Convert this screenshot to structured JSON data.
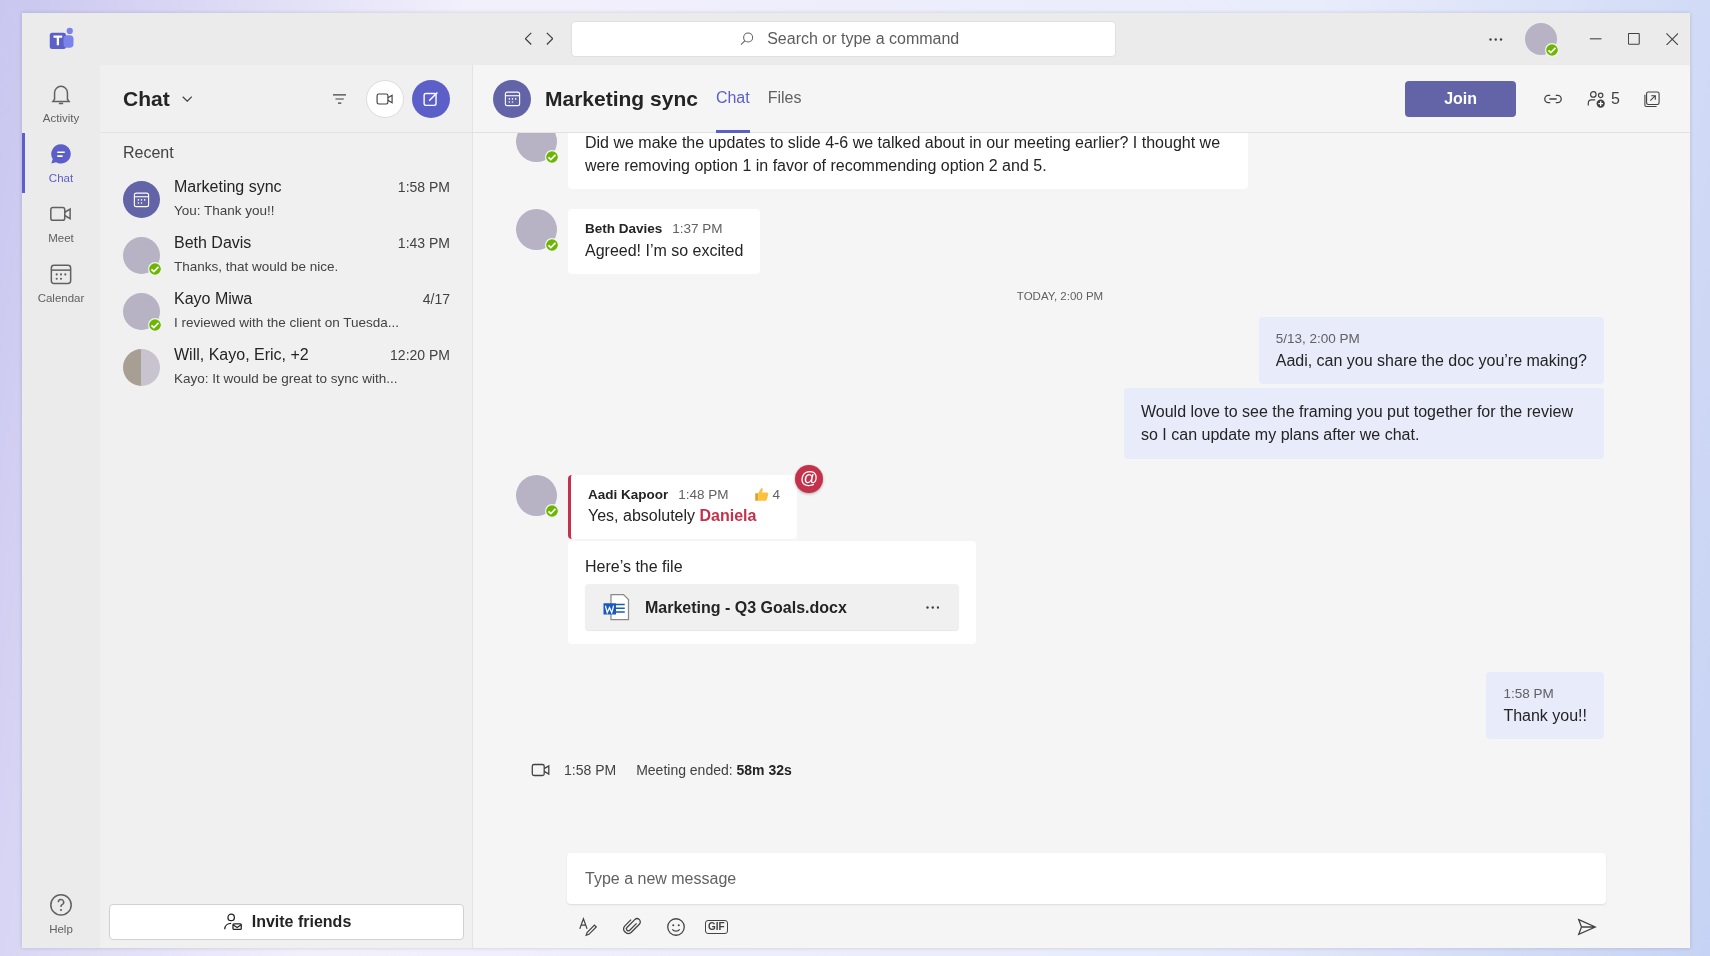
{
  "titlebar": {
    "search": {
      "placeholder": "Search or type a command"
    },
    "user_available": true
  },
  "rail": {
    "items": [
      {
        "label": "Activity",
        "kind": "activity",
        "selected": false
      },
      {
        "label": "Chat",
        "kind": "chat",
        "selected": true
      },
      {
        "label": "Meet",
        "kind": "meet",
        "selected": false
      },
      {
        "label": "Calendar",
        "kind": "calendar",
        "selected": false
      }
    ],
    "help": {
      "label": "Help"
    }
  },
  "chat_list": {
    "title": "Chat",
    "section": "Recent",
    "items": [
      {
        "name": "Marketing sync",
        "preview": "You: Thank you!!",
        "time": "1:58 PM",
        "kind": "meeting"
      },
      {
        "name": "Beth Davis",
        "preview": "Thanks, that would be nice.",
        "time": "1:43 PM",
        "kind": "person",
        "available": true
      },
      {
        "name": "Kayo Miwa",
        "preview": "I reviewed with the client on Tuesda...",
        "time": "4/17",
        "kind": "person",
        "available": true
      },
      {
        "name": "Will, Kayo, Eric, +2",
        "preview": "Kayo: It would be great to sync with...",
        "time": "12:20 PM",
        "kind": "group"
      }
    ],
    "invite_button": "Invite friends"
  },
  "conversation": {
    "title": "Marketing sync",
    "tabs": [
      {
        "label": "Chat",
        "selected": true
      },
      {
        "label": "Files",
        "selected": false
      }
    ],
    "join_button": "Join",
    "participant_count": "5",
    "messages": [
      {
        "kind": "incoming",
        "available": true,
        "body": "Did we make the updates to slide 4-6 we talked about in our meeting earlier? I thought we were removing option 1 in favor of recommending option 2 and 5."
      },
      {
        "kind": "incoming",
        "available": true,
        "author": "Beth Davies",
        "time": "1:37 PM",
        "body": "Agreed! I’m so excited"
      },
      {
        "kind": "divider",
        "text": "TODAY, 2:00 PM"
      },
      {
        "kind": "outgoing",
        "time": "5/13, 2:00 PM",
        "body": "Aadi, can you share the doc you’re making?"
      },
      {
        "kind": "outgoing",
        "body": "Would love to see the framing you put together for the review so I can update my plans after we chat."
      },
      {
        "kind": "incoming",
        "available": true,
        "author": "Aadi Kapoor",
        "time": "1:48 PM",
        "mentioned": true,
        "body": "Yes, absolutely **Daniela**",
        "reaction_count": "4",
        "mention_badge": "@"
      },
      {
        "kind": "incoming",
        "body": "Here’s the file",
        "file": "Marketing - Q3 Goals.docx"
      },
      {
        "kind": "outgoing",
        "time": "1:58 PM",
        "body": "Thank you!!"
      },
      {
        "kind": "event",
        "time": "1:58 PM",
        "body": "Meeting ended: **58m 32s**"
      }
    ],
    "composer": {
      "placeholder": "Type a new message",
      "tools": [
        {
          "kind": "format"
        },
        {
          "kind": "attach"
        },
        {
          "kind": "emoji"
        },
        {
          "kind": "gif",
          "label": "GIF"
        }
      ]
    }
  }
}
